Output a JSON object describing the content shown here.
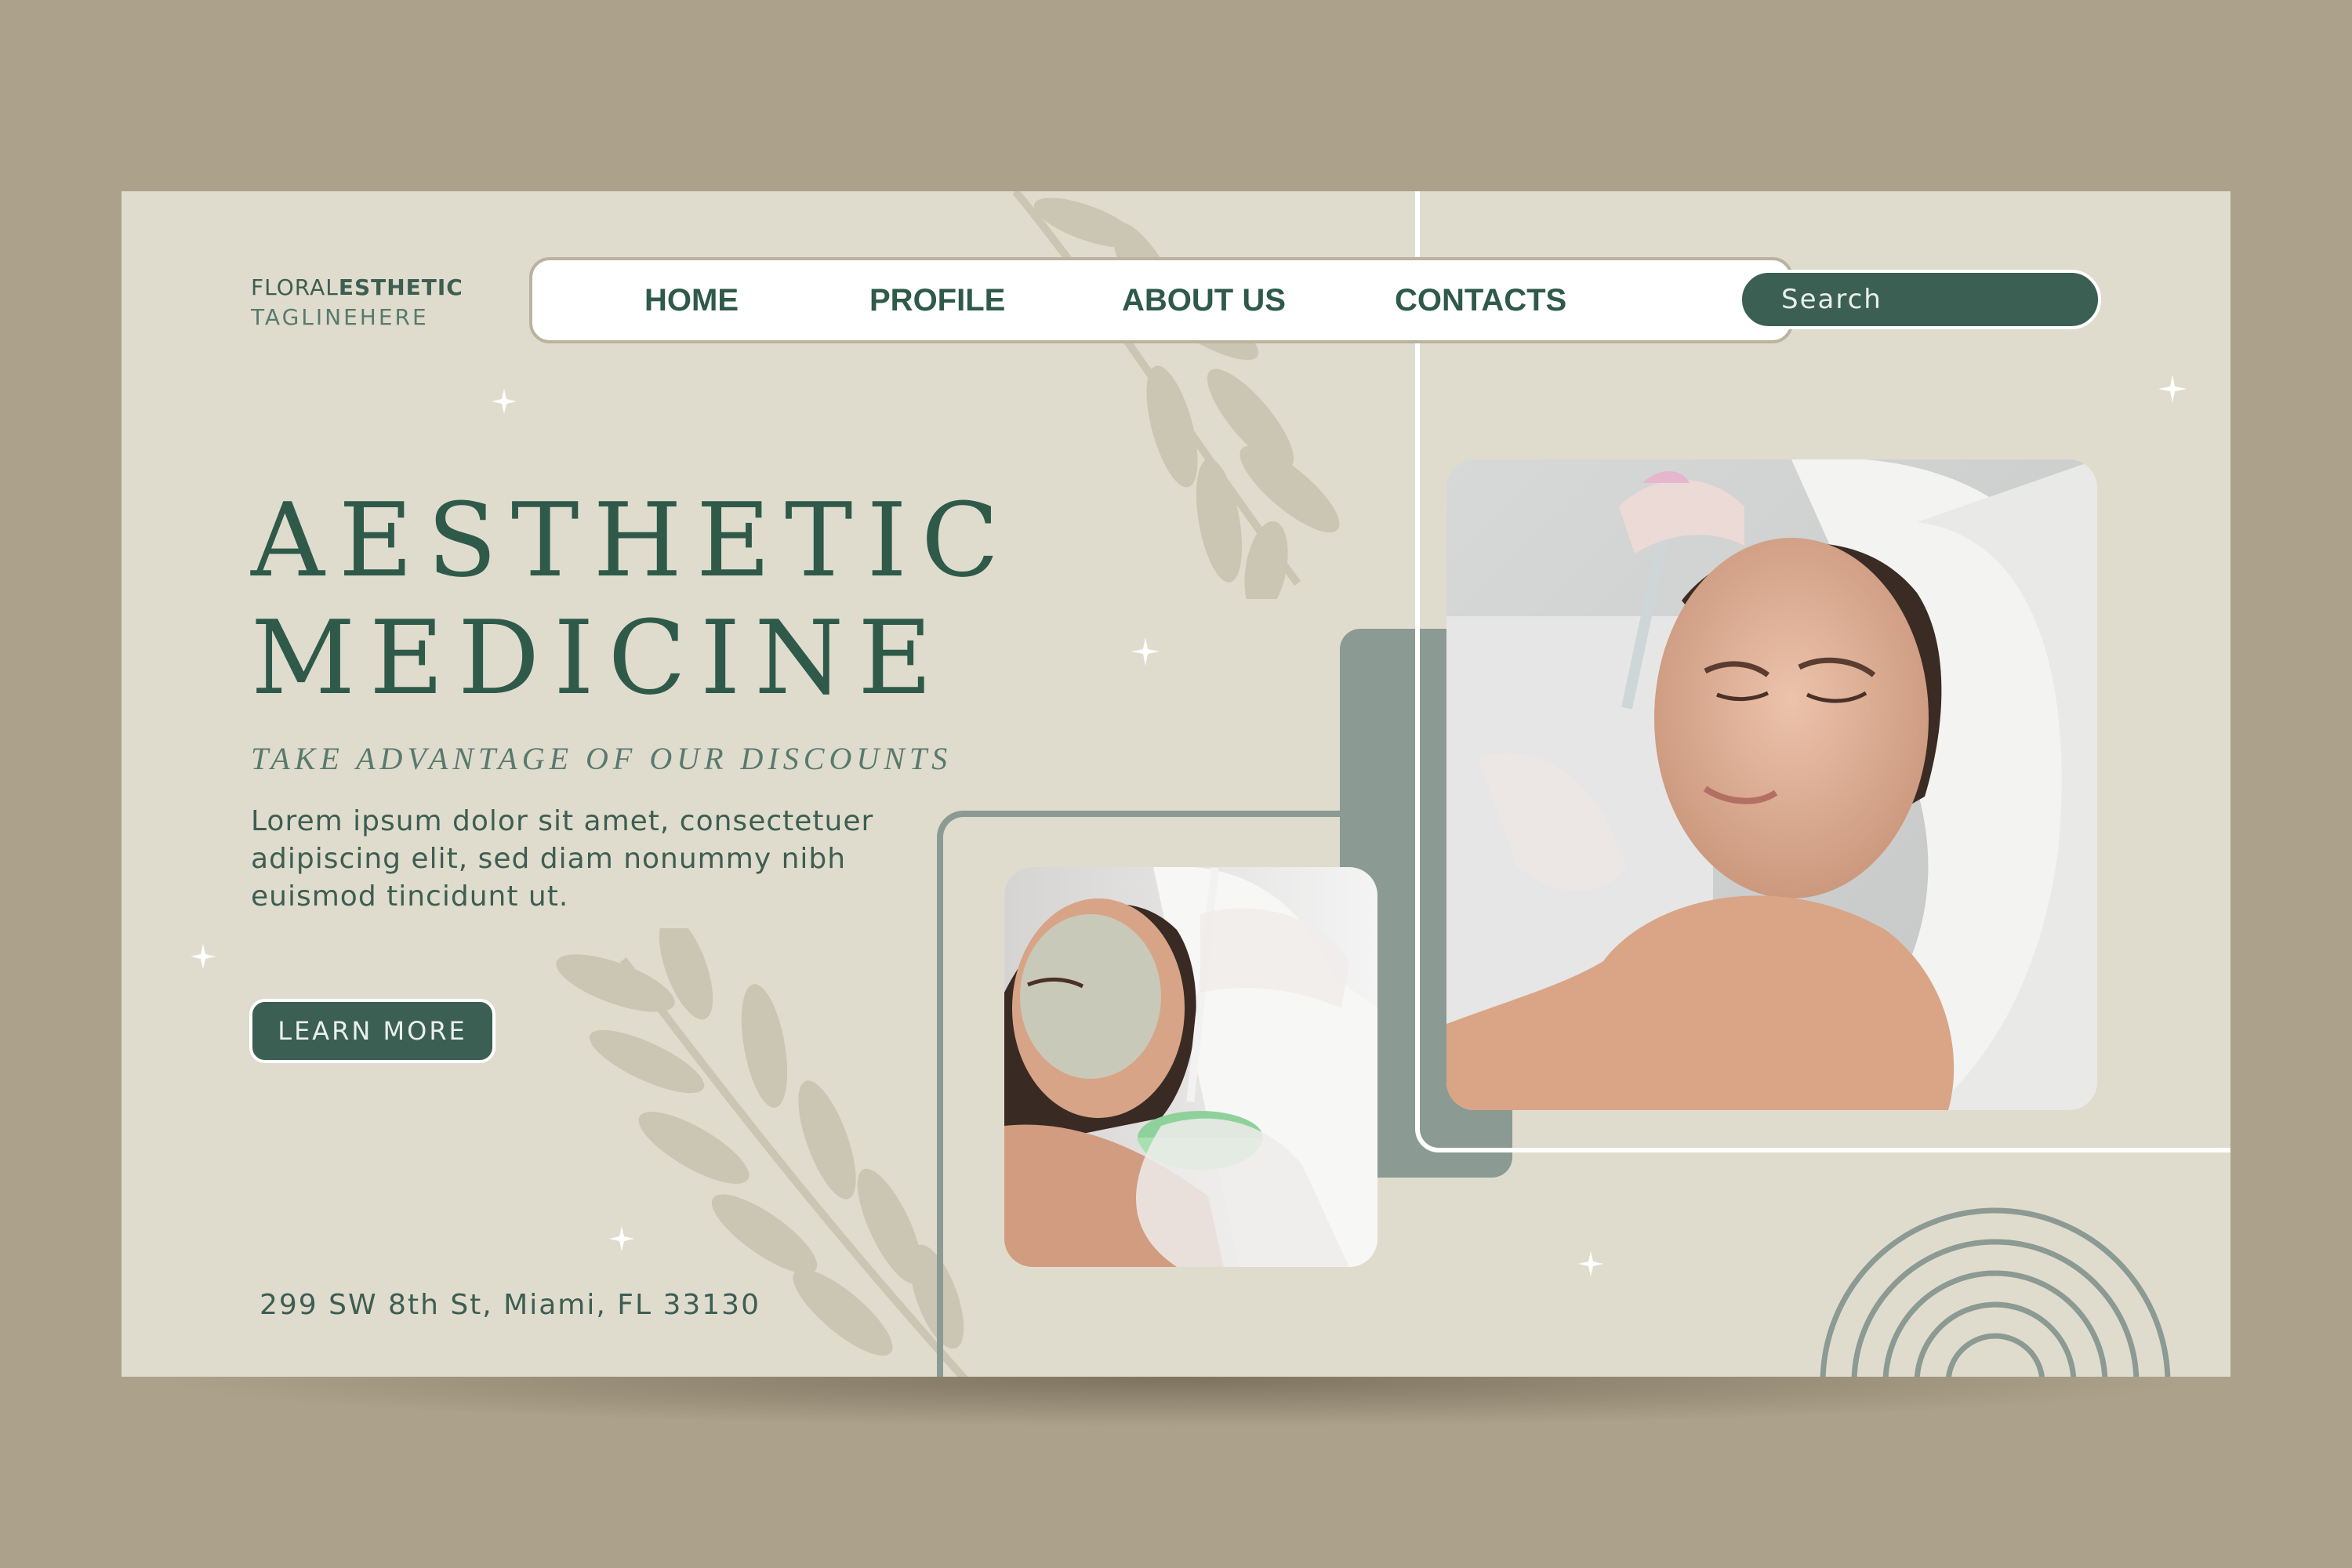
{
  "brand": {
    "name_light": "FLORAL",
    "name_bold": "ESTHETIC",
    "tagline": "TAGLINEHERE"
  },
  "nav": {
    "items": [
      "HOME",
      "PROFILE",
      "ABOUT US",
      "CONTACTS"
    ]
  },
  "search": {
    "placeholder": "Search"
  },
  "hero": {
    "title_line1": "AESTHETIC",
    "title_line2": "MEDICINE",
    "subtitle": "TAKE ADVANTAGE OF OUR DISCOUNTS",
    "body": "Lorem ipsum dolor sit amet, consectetuer adipiscing elit, sed diam nonummy nibh euismod tincidunt ut.",
    "cta_label": "LEARN MORE"
  },
  "footer": {
    "address": "299 SW 8th St, Miami, FL 33130"
  },
  "colors": {
    "background": "#aca18a",
    "card": "#e0dccd",
    "primary": "#3b5f53",
    "accent": "#8b9a93"
  },
  "icons": [
    "sparkle-icon",
    "rainbow-arcs-icon",
    "leaf-branch-shadow"
  ]
}
